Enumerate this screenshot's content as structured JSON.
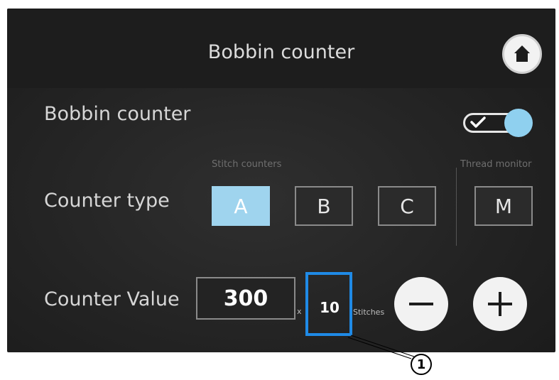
{
  "header": {
    "title": "Bobbin counter",
    "home_icon": "home-icon"
  },
  "bobbin_row": {
    "label": "Bobbin counter",
    "toggle_on": true
  },
  "counter_type": {
    "label": "Counter type",
    "stitch_group_label": "Stitch counters",
    "thread_group_label": "Thread monitor",
    "options": [
      "A",
      "B",
      "C",
      "M"
    ],
    "selected": "A"
  },
  "counter_value": {
    "label": "Counter Value",
    "value": "300",
    "multiplier": "x",
    "unit_value": "10",
    "unit_label": "Stitches",
    "minus_icon": "minus-icon",
    "plus_icon": "plus-icon"
  },
  "callout": {
    "number": "1"
  },
  "colors": {
    "accent": "#9fd4ee",
    "highlight": "#1f8ae6",
    "background": "#232323"
  }
}
